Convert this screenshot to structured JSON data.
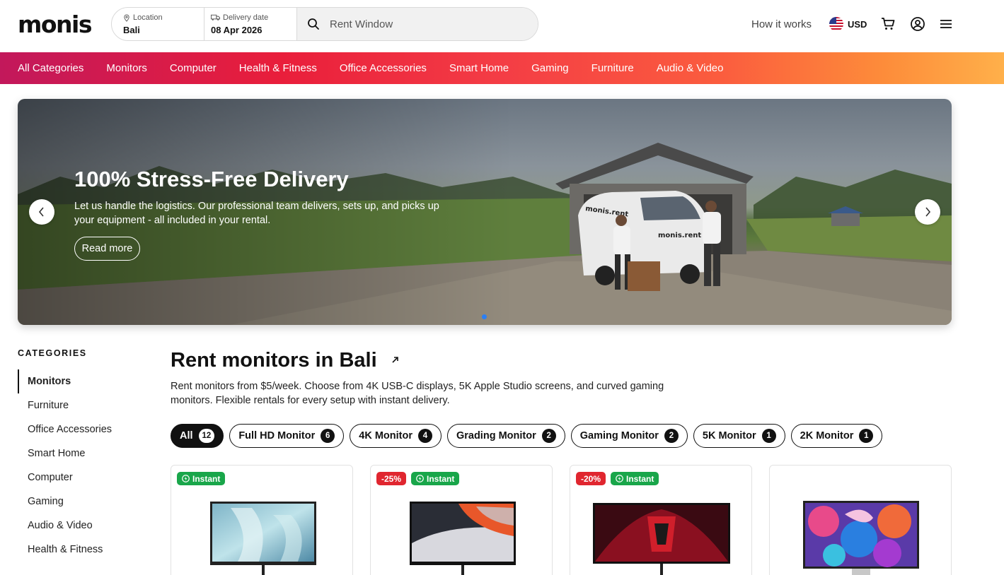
{
  "brand": {
    "logo": "monis"
  },
  "search": {
    "location_label": "Location",
    "location_value": "Bali",
    "delivery_label": "Delivery date",
    "delivery_value": "08 Apr 2026",
    "placeholder": "Rent Window"
  },
  "header": {
    "how_it_works": "How it works",
    "currency": "USD"
  },
  "nav": {
    "items": [
      "All Categories",
      "Monitors",
      "Computer",
      "Health & Fitness",
      "Office Accessories",
      "Smart Home",
      "Gaming",
      "Furniture",
      "Audio & Video"
    ]
  },
  "hero": {
    "title": "100% Stress-Free Delivery",
    "text": "Let us handle the logistics. Our professional team delivers, sets up, and picks up your equipment - all included in your rental.",
    "button": "Read more",
    "van_label": "monis.rent"
  },
  "sidebar": {
    "heading": "CATEGORIES",
    "items": [
      "Monitors",
      "Furniture",
      "Office Accessories",
      "Smart Home",
      "Computer",
      "Gaming",
      "Audio & Video",
      "Health & Fitness"
    ],
    "active": "Monitors"
  },
  "main": {
    "title": "Rent monitors in Bali",
    "description": "Rent monitors from $5/week. Choose from 4K USB-C displays, 5K Apple Studio screens, and curved gaming monitors. Flexible rentals for every setup with instant delivery."
  },
  "filters": [
    {
      "label": "All",
      "count": "12",
      "active": true
    },
    {
      "label": "Full HD Monitor",
      "count": "6"
    },
    {
      "label": "4K Monitor",
      "count": "4"
    },
    {
      "label": "Grading Monitor",
      "count": "2"
    },
    {
      "label": "Gaming Monitor",
      "count": "2"
    },
    {
      "label": "5K Monitor",
      "count": "1"
    },
    {
      "label": "2K Monitor",
      "count": "1"
    }
  ],
  "products": [
    {
      "discount": "",
      "instant": "Instant"
    },
    {
      "discount": "-25%",
      "instant": "Instant"
    },
    {
      "discount": "-20%",
      "instant": "Instant"
    },
    {
      "discount": "",
      "instant": ""
    }
  ],
  "colors": {
    "accent_red": "#e0262f",
    "instant_green": "#19a64a",
    "carousel_dot": "#2a7ff5"
  }
}
